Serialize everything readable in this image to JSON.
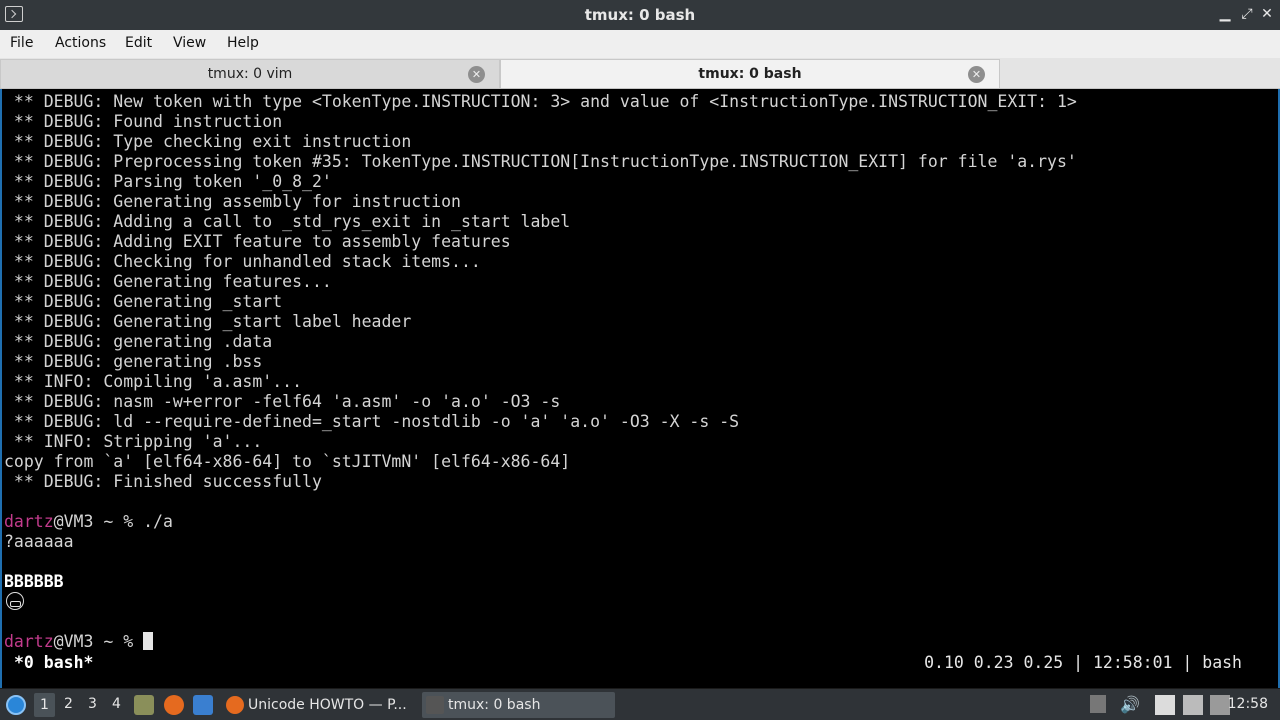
{
  "window": {
    "title": "tmux: 0 bash"
  },
  "menu": [
    "File",
    "Actions",
    "Edit",
    "View",
    "Help"
  ],
  "tabs": [
    {
      "label": "tmux: 0 vim",
      "active": false
    },
    {
      "label": "tmux: 0 bash",
      "active": true
    }
  ],
  "terminal": {
    "lines": [
      " ** DEBUG: New token with type <TokenType.INSTRUCTION: 3> and value of <InstructionType.INSTRUCTION_EXIT: 1>",
      " ** DEBUG: Found instruction",
      " ** DEBUG: Type checking exit instruction",
      " ** DEBUG: Preprocessing token #35: TokenType.INSTRUCTION[InstructionType.INSTRUCTION_EXIT] for file 'a.rys'",
      " ** DEBUG: Parsing token '_0_8_2'",
      " ** DEBUG: Generating assembly for instruction",
      " ** DEBUG: Adding a call to _std_rys_exit in _start label",
      " ** DEBUG: Adding EXIT feature to assembly features",
      " ** DEBUG: Checking for unhandled stack items...",
      " ** DEBUG: Generating features...",
      " ** DEBUG: Generating _start",
      " ** DEBUG: Generating _start label header",
      " ** DEBUG: generating .data",
      " ** DEBUG: generating .bss",
      " ** INFO: Compiling 'a.asm'...",
      " ** DEBUG: nasm -w+error -felf64 'a.asm' -o 'a.o' -O3 -s",
      " ** DEBUG: ld --require-defined=_start -nostdlib -o 'a' 'a.o' -O3 -X -s -S",
      " ** INFO: Stripping 'a'...",
      "copy from `a' [elf64-x86-64] to `stJITVmN' [elf64-x86-64]",
      " ** DEBUG: Finished successfully"
    ],
    "prompt_user": "dartz",
    "prompt_rest": "@VM3 ~ % ",
    "command": "./a",
    "output1": "?aaaaaa",
    "output2": "BBBBBB",
    "status_left": "*0 bash*",
    "status_right": "0.10 0.23 0.25 | 12:58:01 | bash"
  },
  "taskbar": {
    "workspaces": [
      "1",
      "2",
      "3",
      "4"
    ],
    "tasks": [
      {
        "label": "Unicode HOWTO — P...",
        "icon": "firefox-icon",
        "active": false
      },
      {
        "label": "tmux: 0 bash",
        "icon": "terminal-icon",
        "active": true
      }
    ],
    "clock": "12:58"
  },
  "colors": {
    "prompt_user": "#c23b8c",
    "terminal_bg": "#000000",
    "titlebar_bg": "#33383c"
  }
}
